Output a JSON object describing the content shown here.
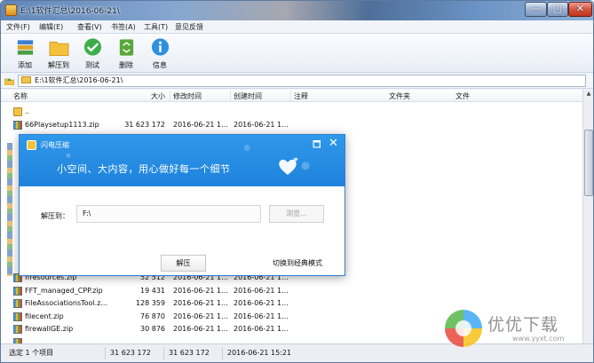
{
  "window": {
    "title": "E:\\1软件汇总\\2016-06-21\\",
    "min_label": "—",
    "max_label": "□",
    "close_label": "✕"
  },
  "menu": [
    "文件(F)",
    "编辑(E)",
    "查看(V)",
    "书签(A)",
    "工具(T)",
    "意见反馈"
  ],
  "toolbar": {
    "add": "添加",
    "extract": "解压到",
    "test": "测试",
    "delete": "删除",
    "info": "信息"
  },
  "address": {
    "path": "E:\\1软件汇总\\2016-06-21\\"
  },
  "columns": {
    "name": "名称",
    "size": "大小",
    "modified": "修改时间",
    "created": "创建时间",
    "comment": "注释",
    "folder": "文件夹",
    "file": "文件"
  },
  "files": {
    "up": "..",
    "r0": {
      "name": "66Playsetup1113.zip",
      "size": "31 623 172",
      "modified": "2016-06-21 1...",
      "created": "2016-06-21 1..."
    },
    "r1": {
      "name": "ffresources.zip",
      "size": "52 512",
      "modified": "2016-06-21 1...",
      "created": "2016-06-21 1..."
    },
    "r2": {
      "name": "FFT_managed_CPP.zip",
      "size": "19 431",
      "modified": "2016-06-21 1...",
      "created": "2016-06-21 1..."
    },
    "r3": {
      "name": "FileAssociationsTool.z...",
      "size": "128 359",
      "modified": "2016-06-21 1...",
      "created": "2016-06-21 1..."
    },
    "r4": {
      "name": "filecent.zip",
      "size": "76 870",
      "modified": "2016-06-21 1...",
      "created": "2016-06-21 1..."
    },
    "r5": {
      "name": "firewallGE.zip",
      "size": "30 876",
      "modified": "2016-06-21 1...",
      "created": "2016-06-21 1..."
    }
  },
  "status": {
    "selection": "选定 1 个项目",
    "size1": "31 623 172",
    "size2": "31 623 172",
    "date": "2016-06-21 15:21"
  },
  "dialog": {
    "title": "闪电压缩",
    "pin_icon": "🗖",
    "close_label": "✕",
    "slogan": "小空间、大内容，用心做好每一个细节",
    "extract_label": "解压到：",
    "path_value": "F:\\",
    "browse_label": "浏览...",
    "extract_button": "解压",
    "switch_link": "切换到经典模式"
  },
  "watermark": {
    "text": "优优下载",
    "url": "www.yyxt.com"
  }
}
